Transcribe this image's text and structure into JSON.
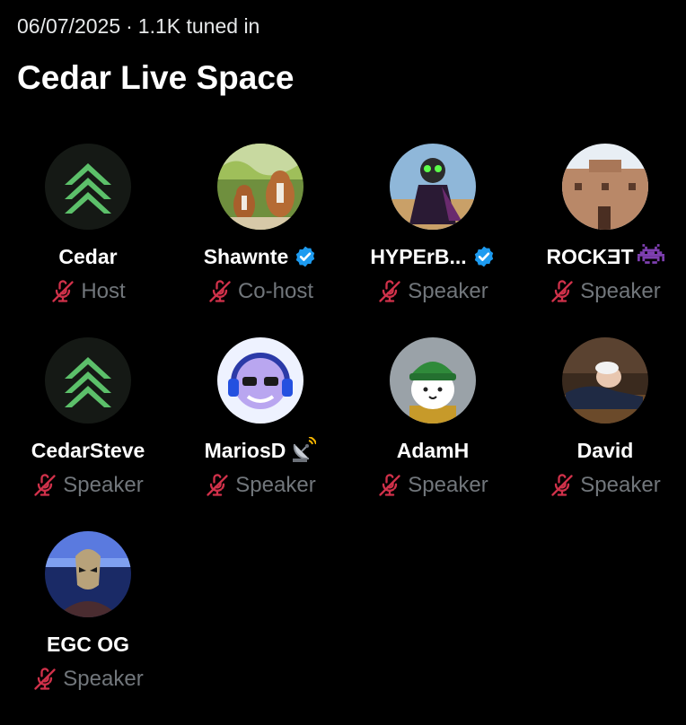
{
  "header": {
    "date": "06/07/2025",
    "separator": "·",
    "listeners": "1.1K tuned in",
    "title": "Cedar Live Space"
  },
  "colors": {
    "background": "#000000",
    "muted_text": "#71767b",
    "mute_icon": "#d0314a",
    "verified": "#1d9bf0",
    "cedar_green": "#5cc06a"
  },
  "participants": [
    {
      "name": "Cedar",
      "role": "Host",
      "avatar": "cedar-logo",
      "verified": false
    },
    {
      "name": "Shawnte",
      "role": "Co-host",
      "avatar": "boxer-dogs-photo",
      "verified": true
    },
    {
      "name": "HYPErB...",
      "role": "Speaker",
      "avatar": "robot-figure-photo",
      "verified": true
    },
    {
      "name": "ROCKƎT",
      "role": "Speaker",
      "avatar": "adobe-building-photo",
      "verified": false,
      "emoji": "space-invader-icon"
    },
    {
      "name": "CedarSteve",
      "role": "Speaker",
      "avatar": "cedar-logo",
      "verified": false
    },
    {
      "name": "MariosD",
      "role": "Speaker",
      "avatar": "headphones-man-art",
      "verified": false,
      "emoji": "satellite-dish-icon"
    },
    {
      "name": "AdamH",
      "role": "Speaker",
      "avatar": "beanie-cat-art",
      "verified": false
    },
    {
      "name": "David",
      "role": "Speaker",
      "avatar": "sleeping-man-photo",
      "verified": false
    },
    {
      "name": "EGC OG",
      "role": "Speaker",
      "avatar": "masked-figure-art",
      "verified": false
    }
  ]
}
